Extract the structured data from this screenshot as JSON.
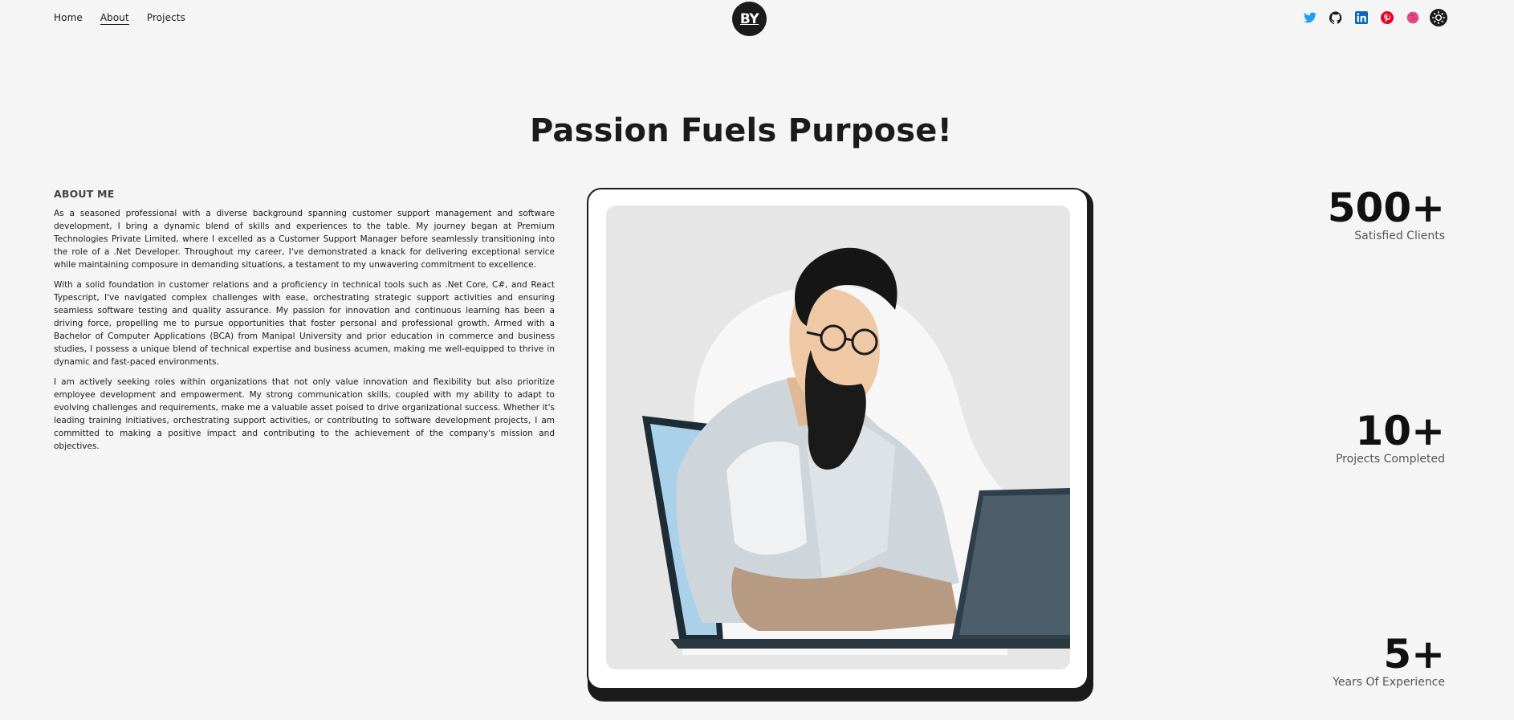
{
  "nav": {
    "items": [
      {
        "label": "Home",
        "active": false
      },
      {
        "label": "About",
        "active": true
      },
      {
        "label": "Projects",
        "active": false
      }
    ]
  },
  "logo": {
    "text": "BY"
  },
  "socials": [
    {
      "icon": "twitter-icon",
      "color": "#1da1f2"
    },
    {
      "icon": "github-icon",
      "color": "#1b1b1b"
    },
    {
      "icon": "linkedin-icon",
      "color": "#0a66c2"
    },
    {
      "icon": "pinterest-icon",
      "color": "#e60023"
    },
    {
      "icon": "dribbble-icon",
      "color": "#ea4c89"
    },
    {
      "icon": "theme-toggle-sun-icon",
      "color": "#1b1b1b"
    }
  ],
  "hero": {
    "title": "Passion Fuels Purpose!"
  },
  "about": {
    "heading": "About Me",
    "paragraphs": [
      "As a seasoned professional with a diverse background spanning customer support management and software development, I bring a dynamic blend of skills and experiences to the table. My journey began at Premium Technologies Private Limited, where I excelled as a Customer Support Manager before seamlessly transitioning into the role of a .Net Developer. Throughout my career, I've demonstrated a knack for delivering exceptional service while maintaining composure in demanding situations, a testament to my unwavering commitment to excellence.",
      "With a solid foundation in customer relations and a proficiency in technical tools such as .Net Core, C#, and React Typescript, I've navigated complex challenges with ease, orchestrating strategic support activities and ensuring seamless software testing and quality assurance. My passion for innovation and continuous learning has been a driving force, propelling me to pursue opportunities that foster personal and professional growth. Armed with a Bachelor of Computer Applications (BCA) from Manipal University and prior education in commerce and business studies, I possess a unique blend of technical expertise and business acumen, making me well-equipped to thrive in dynamic and fast-paced environments.",
      "I am actively seeking roles within organizations that not only value innovation and flexibility but also prioritize employee development and empowerment. My strong communication skills, coupled with my ability to adapt to evolving challenges and requirements, make me a valuable asset poised to drive organizational success. Whether it's leading training initiatives, orchestrating support activities, or contributing to software development projects, I am committed to making a positive impact and contributing to the achievement of the company's mission and objectives."
    ]
  },
  "stats": [
    {
      "value": "500+",
      "label": "Satisfied Clients"
    },
    {
      "value": "10+",
      "label": "Projects Completed"
    },
    {
      "value": "5+",
      "label": "Years Of Experience"
    }
  ]
}
